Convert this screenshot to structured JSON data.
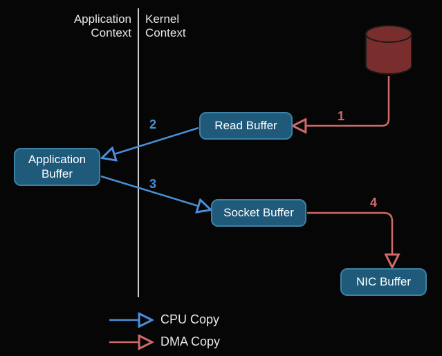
{
  "contexts": {
    "application": "Application\nContext",
    "kernel": "Kernel\nContext"
  },
  "nodes": {
    "app_buffer": "Application\nBuffer",
    "read_buffer": "Read Buffer",
    "socket_buffer": "Socket Buffer",
    "nic_buffer": "NIC Buffer",
    "disk": "disk"
  },
  "steps": {
    "s1": "1",
    "s2": "2",
    "s3": "3",
    "s4": "4"
  },
  "legend": {
    "cpu": "CPU Copy",
    "dma": "DMA Copy"
  },
  "colors": {
    "bg": "#060606",
    "box_fill": "#1f5a7a",
    "box_border": "#3b82a6",
    "blue": "#4a8fd9",
    "red": "#d06a6a",
    "disk_fill": "#7a2d2d",
    "disk_stroke": "#222"
  }
}
